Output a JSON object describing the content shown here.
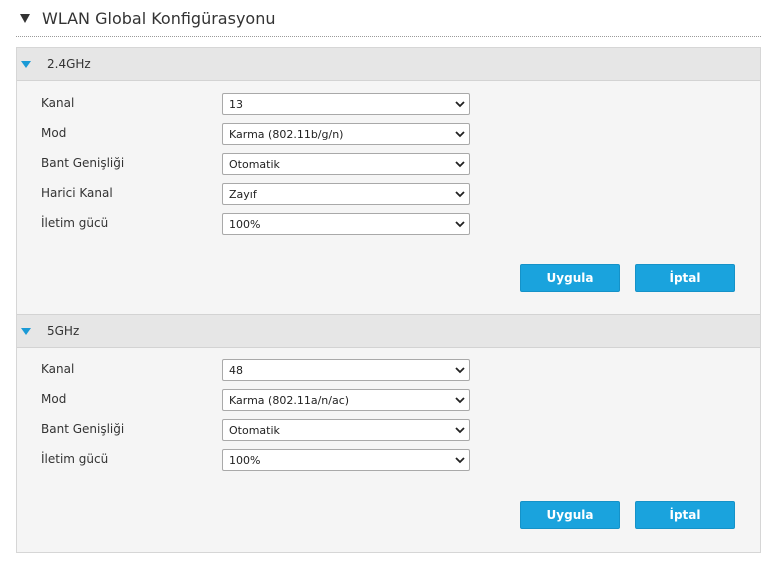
{
  "page": {
    "title": "WLAN Global Konfigürasyonu"
  },
  "sections": [
    {
      "title": "2.4GHz",
      "fields": [
        {
          "label": "Kanal",
          "value": "13"
        },
        {
          "label": "Mod",
          "value": "Karma (802.11b/g/n)"
        },
        {
          "label": "Bant Genişliği",
          "value": "Otomatik"
        },
        {
          "label": "Harici Kanal",
          "value": "Zayıf"
        },
        {
          "label": "İletim gücü",
          "value": "100%"
        }
      ],
      "apply_label": "Uygula",
      "cancel_label": "İptal"
    },
    {
      "title": "5GHz",
      "fields": [
        {
          "label": "Kanal",
          "value": "48"
        },
        {
          "label": "Mod",
          "value": "Karma (802.11a/n/ac)"
        },
        {
          "label": "Bant Genişliği",
          "value": "Otomatik"
        },
        {
          "label": "İletim gücü",
          "value": "100%"
        }
      ],
      "apply_label": "Uygula",
      "cancel_label": "İptal"
    }
  ],
  "colors": {
    "accent": "#1aa3dd",
    "section_arrow": "#1a9ad6",
    "panel_bg": "#f5f5f5",
    "header_bg": "#e6e6e6"
  },
  "icons": {
    "page_collapse": "triangle-down-icon",
    "section_collapse": "triangle-down-icon",
    "select_open": "chevron-down-icon"
  }
}
